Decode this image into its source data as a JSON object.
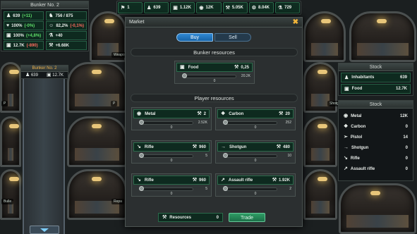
{
  "top_bar": [
    {
      "icon": "soldier-icon",
      "value": "1"
    },
    {
      "icon": "inhabitants-icon",
      "value": "639"
    },
    {
      "icon": "food-icon",
      "value": "1.12K"
    },
    {
      "icon": "metal-icon",
      "value": "12K"
    },
    {
      "icon": "resources-icon",
      "value": "5.05K"
    },
    {
      "icon": "energy-icon",
      "value": "8.04K"
    },
    {
      "icon": "science-icon",
      "value": "729"
    }
  ],
  "bunker_stats": {
    "title": "Bunker No. 2",
    "rows": [
      {
        "icon": "inhabitants-icon",
        "value": "639",
        "delta": "(+11)",
        "delta_type": "pos"
      },
      {
        "icon": "workers-icon",
        "value": "756 / 875",
        "delta": "",
        "delta_type": ""
      },
      {
        "icon": "health-icon",
        "value": "100%",
        "delta": "(-0%)",
        "delta_type": "pos"
      },
      {
        "icon": "morale-icon",
        "value": "82,2%",
        "delta": "(-0,1%)",
        "delta_type": "neg"
      },
      {
        "icon": "food-icon",
        "value": "100%",
        "delta": "(+4,8%)",
        "delta_type": "pos"
      },
      {
        "icon": "science-icon",
        "value": "+40",
        "delta": "",
        "delta_type": ""
      },
      {
        "icon": "food-icon",
        "value": "12.7K",
        "delta": "(-890)",
        "delta_type": "neg"
      },
      {
        "icon": "resources-icon",
        "value": "+6.68K",
        "delta": "",
        "delta_type": ""
      }
    ]
  },
  "bunker_mini": {
    "title": "Bunker No. 2",
    "inhabitants": "639",
    "food": "12.7K"
  },
  "background_labels": {
    "weapons": "Weapo",
    "shotgun": "Shotgun",
    "pistol": "P",
    "repair": "Repa",
    "bullets": "Bulle",
    "p2": "P"
  },
  "market": {
    "title": "Market",
    "tabs": {
      "buy": "Buy",
      "sell": "Sell"
    },
    "bunker_section": "Bunker resources",
    "player_section": "Player resources",
    "bunker_food": {
      "label": "Food",
      "price": "0,25",
      "max": "20.2K",
      "value": "0"
    },
    "player_items": [
      {
        "label": "Metal",
        "icon": "metal-icon",
        "price": "2",
        "max": "2.52K",
        "value": "0"
      },
      {
        "label": "Carbon",
        "icon": "carbon-icon",
        "price": "20",
        "max": "252",
        "value": "0"
      },
      {
        "label": "Rifle",
        "icon": "rifle-icon",
        "price": "960",
        "max": "5",
        "value": "0"
      },
      {
        "label": "Shotgun",
        "icon": "shotgun-icon",
        "price": "480",
        "max": "10",
        "value": "0"
      },
      {
        "label": "Rifle",
        "icon": "rifle-icon",
        "price": "960",
        "max": "5",
        "value": "0"
      },
      {
        "label": "Assault rifle",
        "icon": "assault-rifle-icon",
        "price": "1.92K",
        "max": "2",
        "value": "0"
      }
    ],
    "footer": {
      "resources_label": "Resources",
      "resources_value": "0",
      "trade_label": "Trade"
    }
  },
  "stock_top": {
    "title": "Stock",
    "rows": [
      {
        "label": "Inhabitants",
        "value": "639"
      },
      {
        "label": "Food",
        "value": "12.7K"
      }
    ]
  },
  "stock_bottom": {
    "title": "Stock",
    "rows": [
      {
        "label": "Metal",
        "value": "12K"
      },
      {
        "label": "Carbon",
        "value": "0"
      },
      {
        "label": "Pistol",
        "value": "14"
      },
      {
        "label": "Shotgun",
        "value": "0"
      },
      {
        "label": "Rifle",
        "value": "0"
      },
      {
        "label": "Assault rifle",
        "value": "0"
      }
    ]
  },
  "colors": {
    "accent_blue": "#2f88d4",
    "trade_green": "#2f9c65",
    "positive": "#5fe06a",
    "negative": "#ff6b5e",
    "close_orange": "#f2b53a",
    "bunker_title": "#f0b24a"
  }
}
